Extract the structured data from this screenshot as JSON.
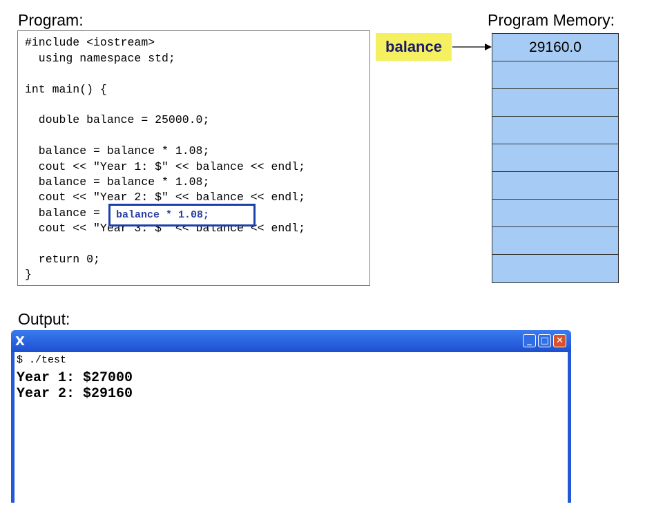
{
  "headings": {
    "program": "Program:",
    "memory": "Program Memory:",
    "output": "Output:"
  },
  "code": {
    "lines": [
      "#include <iostream>",
      "  using namespace std;",
      "int main() {",
      "  double balance = 25000.0;",
      "  balance = balance * 1.08;",
      "  cout << \"Year 1: $\" << balance << endl;",
      "  balance = balance * 1.08;",
      "  cout << \"Year 2: $\" << balance << endl;",
      "  balance =",
      "  cout << \"Year 3: $\" << balance << endl;",
      "  return 0;",
      "}"
    ],
    "highlight": "balance * 1.08;"
  },
  "memory": {
    "variable_name": "balance",
    "cells": [
      "29160.0",
      "",
      "",
      "",
      "",
      "",
      "",
      "",
      ""
    ],
    "label_color": "#f5f060",
    "cell_color": "#a6cbf4"
  },
  "terminal": {
    "icon": "x-window-icon",
    "command": "$ ./test",
    "output_lines": [
      "Year 1: $27000",
      "Year 2: $29160"
    ],
    "buttons": {
      "minimize": "_",
      "maximize": "□",
      "close": "✕"
    }
  }
}
